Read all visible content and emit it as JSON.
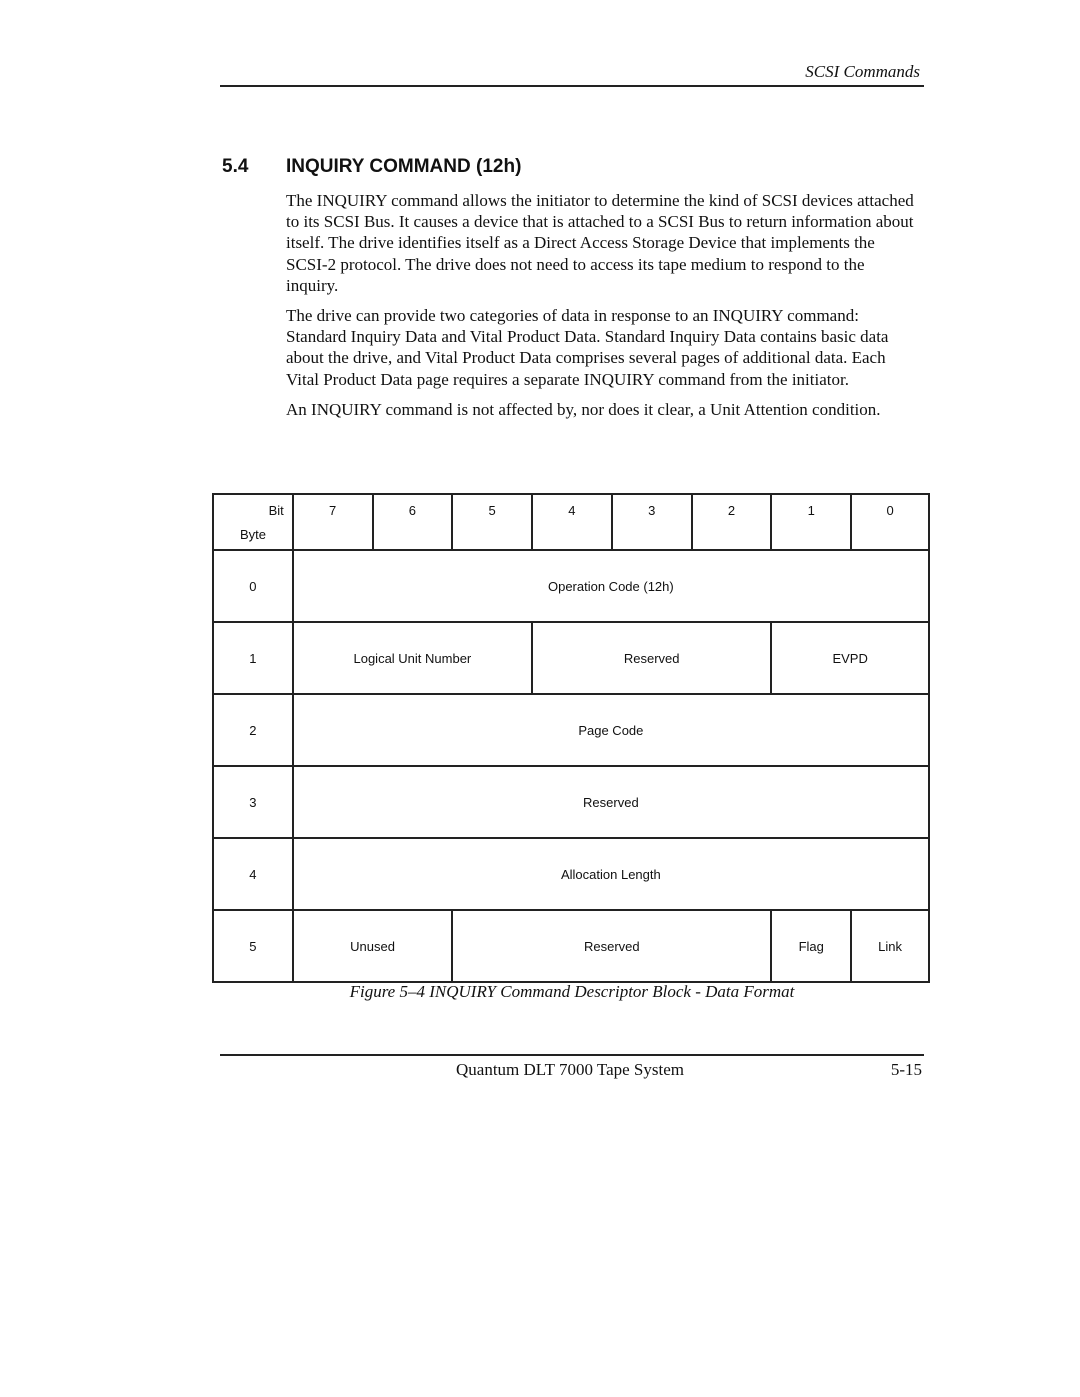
{
  "header": {
    "running_title": "SCSI Commands"
  },
  "section": {
    "number": "5.4",
    "title": "INQUIRY COMMAND  (12h)"
  },
  "paragraphs": [
    "The INQUIRY command allows the initiator to determine the kind of SCSI devices attached to its SCSI Bus. It causes a device that is attached to a SCSI Bus to return information about itself. The drive identifies itself as a Direct Access Storage Device that implements the SCSI-2 protocol. The drive does not need to access its tape medium to respond to the inquiry.",
    "The drive can provide two categories of data in response to an INQUIRY command: Standard Inquiry Data and Vital Product Data. Standard Inquiry Data contains basic data about the drive, and Vital Product Data comprises several pages of additional data. Each Vital Product Data page requires a separate INQUIRY command from the initiator.",
    "An INQUIRY command is not affected by, nor does it clear, a Unit Attention condition."
  ],
  "table": {
    "bit_label": "Bit",
    "byte_label": "Byte",
    "bits": [
      "7",
      "6",
      "5",
      "4",
      "3",
      "2",
      "1",
      "0"
    ],
    "rows": [
      {
        "byte": "0",
        "fields": [
          {
            "label": "Operation Code (12h)",
            "span": 8
          }
        ]
      },
      {
        "byte": "1",
        "fields": [
          {
            "label": "Logical Unit Number",
            "span": 3
          },
          {
            "label": "Reserved",
            "span": 3
          },
          {
            "label": "EVPD",
            "span": 2
          }
        ]
      },
      {
        "byte": "2",
        "fields": [
          {
            "label": "Page Code",
            "span": 8
          }
        ]
      },
      {
        "byte": "3",
        "fields": [
          {
            "label": "Reserved",
            "span": 8
          }
        ]
      },
      {
        "byte": "4",
        "fields": [
          {
            "label": "Allocation Length",
            "span": 8
          }
        ]
      },
      {
        "byte": "5",
        "fields": [
          {
            "label": "Unused",
            "span": 2
          },
          {
            "label": "Reserved",
            "span": 4
          },
          {
            "label": "Flag",
            "span": 1
          },
          {
            "label": "Link",
            "span": 1
          }
        ]
      }
    ]
  },
  "caption": "Figure 5–4  INQUIRY Command Descriptor Block - Data Format",
  "footer": {
    "title": "Quantum DLT 7000 Tape System",
    "page": "5-15"
  }
}
